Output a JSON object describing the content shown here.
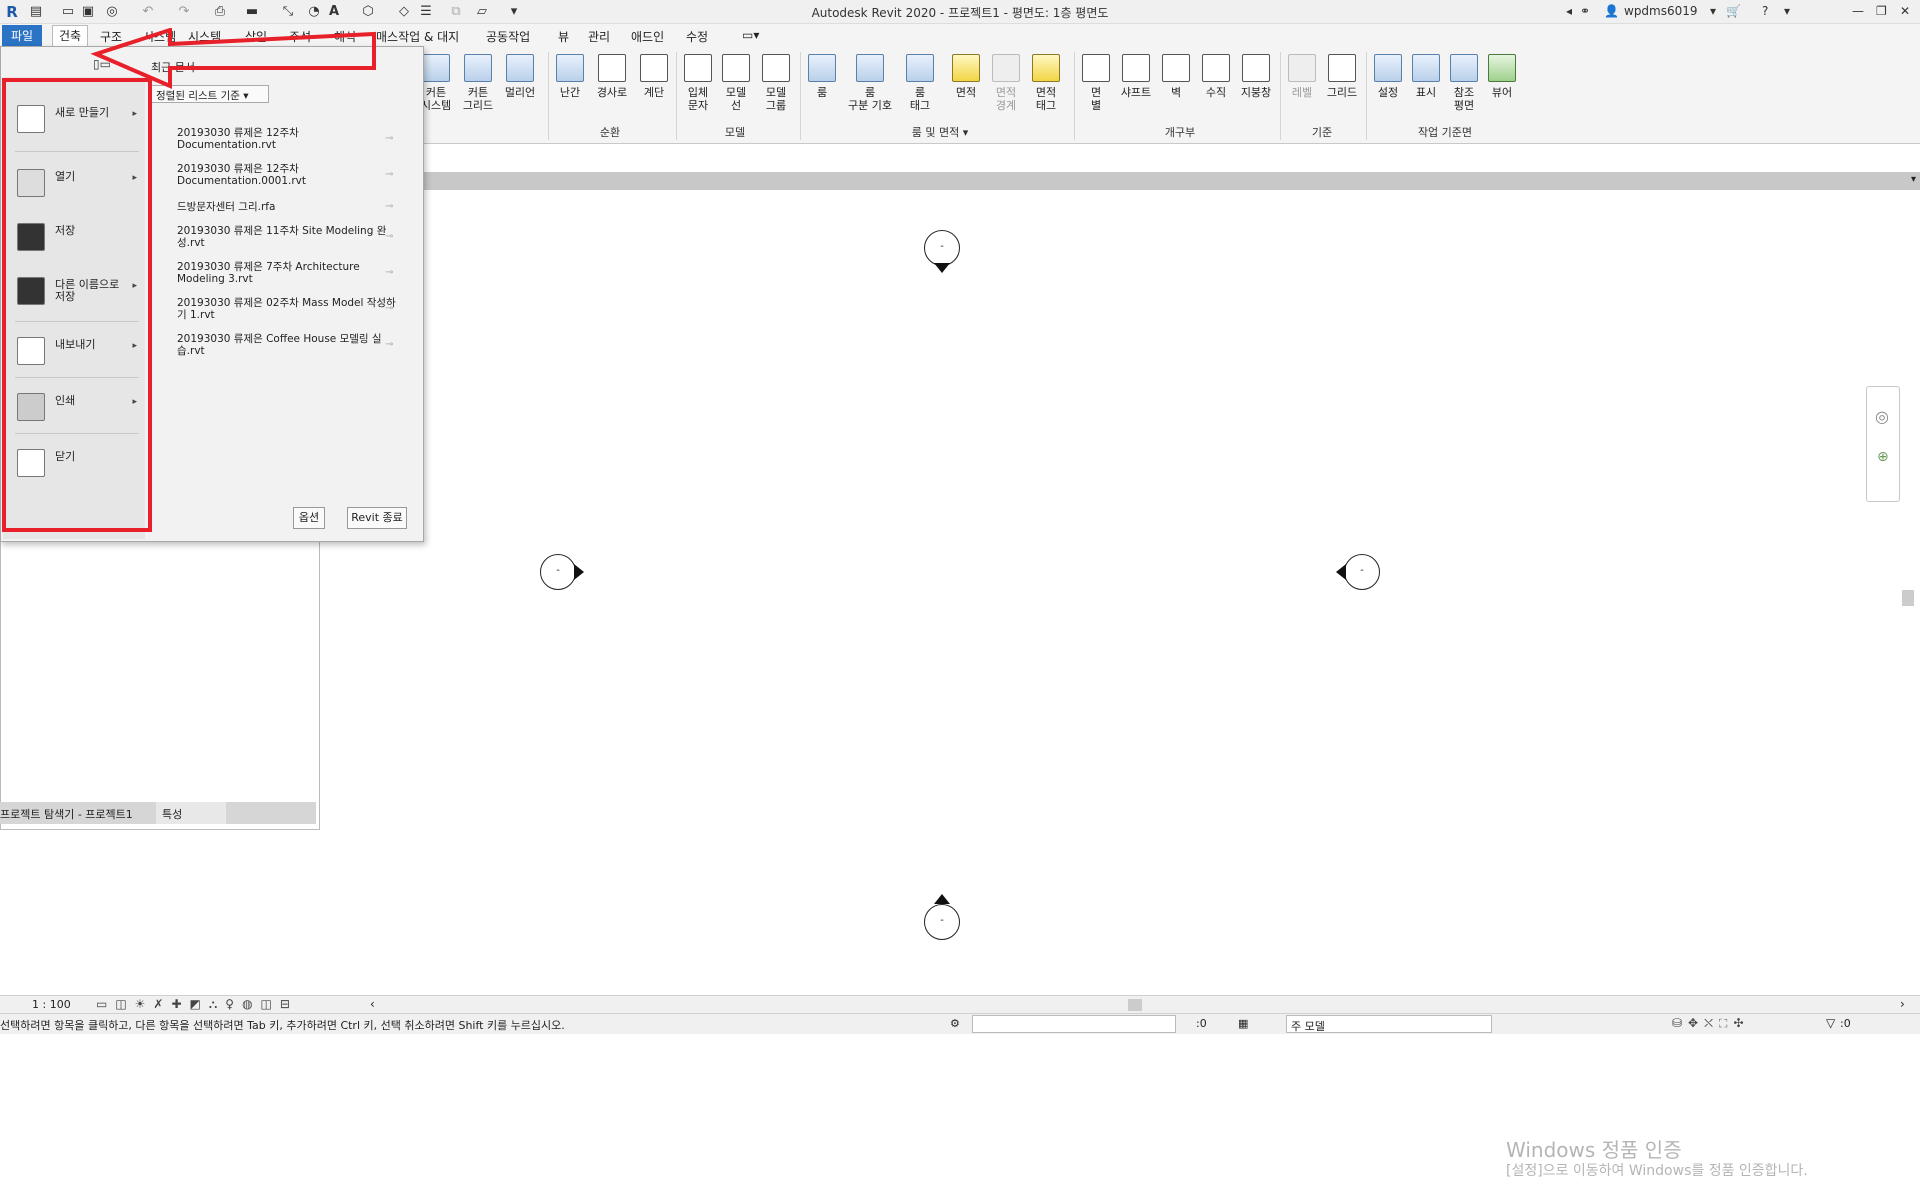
{
  "title": "Autodesk Revit 2020 - 프로젝트1 - 평면도: 1층 평면도",
  "user": "wpdms6019",
  "quick_access_icons": [
    "revit-logo-icon",
    "open-icon",
    "save-icon",
    "sync-icon",
    "undo-icon",
    "redo-icon",
    "print-icon",
    "measure-icon",
    "dimension-icon",
    "tag-icon",
    "text-icon",
    "3d-view-icon",
    "section-icon",
    "thin-lines-icon",
    "close-hidden-icon",
    "switch-windows-icon"
  ],
  "tabs": [
    "파일",
    "건축",
    "구조",
    "시스템",
    "시스템",
    "삽입",
    "주석",
    "해석",
    "매스작업 & 대지",
    "공동작업",
    "뷰",
    "관리",
    "애드인",
    "수정"
  ],
  "ribbon": {
    "buttons": [
      {
        "label": "커튼\n시스템"
      },
      {
        "label": "커튼\n그리드"
      },
      {
        "label": "멀리언"
      },
      {
        "label": "난간"
      },
      {
        "label": "경사로"
      },
      {
        "label": "계단"
      },
      {
        "label": "입체\n문자"
      },
      {
        "label": "모델\n선"
      },
      {
        "label": "모델\n그룹"
      },
      {
        "label": "룸"
      },
      {
        "label": "룸\n구분 기호"
      },
      {
        "label": "룸\n태그"
      },
      {
        "label": "면적"
      },
      {
        "label": "면적\n경계"
      },
      {
        "label": "면적\n태그"
      },
      {
        "label": "면\n별"
      },
      {
        "label": "샤프트"
      },
      {
        "label": "벽"
      },
      {
        "label": "수직"
      },
      {
        "label": "지붕창"
      },
      {
        "label": "레벨"
      },
      {
        "label": "그리드"
      },
      {
        "label": "설정"
      },
      {
        "label": "표시"
      },
      {
        "label": "참조\n평면"
      },
      {
        "label": "뷰어"
      }
    ],
    "panels": [
      "순환",
      "모델",
      "룸 및 면적 ▾",
      "개구부",
      "기준",
      "작업 기준면"
    ]
  },
  "app_menu": {
    "recent_header": "최근 문서",
    "sort_label": "정렬된 리스트 기준",
    "items": [
      "새로 만들기",
      "열기",
      "저장",
      "다른 이름으로 저장",
      "내보내기",
      "인쇄",
      "닫기"
    ],
    "recent_files": [
      "20193030 류제은 12주차 Documentation.rvt",
      "20193030 류제은 12주차 Documentation.0001.rvt",
      "드방문자센터 그리.rfa",
      "20193030 류제은 11주차 Site Modeling 완성.rvt",
      "20193030 류제은 7주차 Architecture Modeling 3.rvt",
      "20193030 류제은 02주차 Mass Model 작성하기 1.rvt",
      "20193030 류제은 Coffee House 모델링 실습.rvt"
    ],
    "options_btn": "옵션",
    "exit_btn": "Revit 종료"
  },
  "project_browser": {
    "tab1": "프로젝트 탐색기 - 프로젝트1",
    "tab2": "특성"
  },
  "scale": "1 : 100",
  "status": "선택하려면 항목을 클릭하고, 다른 항목을 선택하려면 Tab 키, 추가하려면 Ctrl 키, 선택 취소하려면 Shift 키를 누르십시오.",
  "status_right": {
    "count": ":0",
    "model": "주 모델",
    "filter": ":0"
  },
  "watermark": {
    "line1": "Windows 정품 인증",
    "line2": "[설정]으로 이동하여 Windows를 정품 인증합니다."
  },
  "elevation_marker_label": "-"
}
